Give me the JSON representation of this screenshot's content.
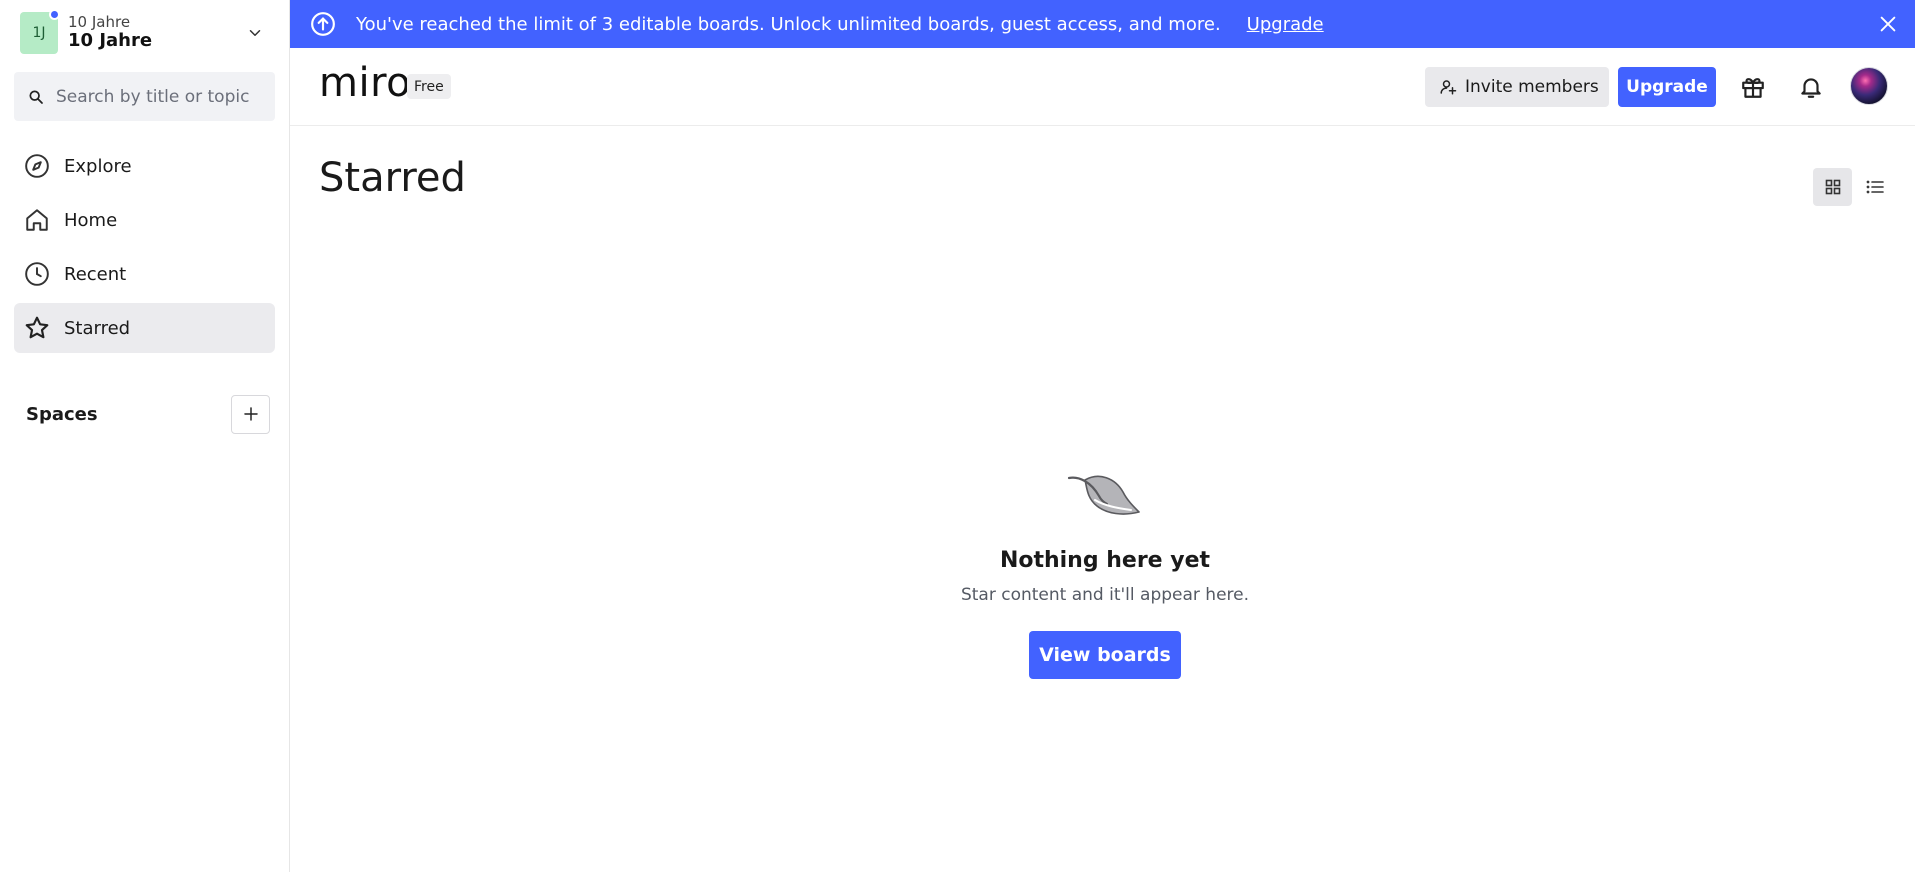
{
  "team": {
    "avatar_initials": "1J",
    "subtitle": "10 Jahre",
    "name": "10 Jahre"
  },
  "search": {
    "placeholder": "Search by title or topic",
    "value": ""
  },
  "nav": {
    "items": [
      {
        "label": "Explore",
        "icon": "compass-icon",
        "active": false
      },
      {
        "label": "Home",
        "icon": "home-icon",
        "active": false
      },
      {
        "label": "Recent",
        "icon": "clock-icon",
        "active": false
      },
      {
        "label": "Starred",
        "icon": "star-icon",
        "active": true
      }
    ]
  },
  "spaces": {
    "title": "Spaces",
    "add_icon": "plus-icon"
  },
  "banner": {
    "text": "You've reached the limit of 3 editable boards. Unlock unlimited boards, guest access, and more.",
    "link": "Upgrade"
  },
  "header": {
    "logo": "miro",
    "plan": "Free",
    "invite_label": "Invite members",
    "upgrade_label": "Upgrade"
  },
  "main": {
    "title": "Starred",
    "empty_title": "Nothing here yet",
    "empty_subtitle": "Star content and it'll appear here.",
    "cta_label": "View boards"
  },
  "colors": {
    "accent": "#4262ff",
    "team_avatar_bg": "#b5ebc6",
    "active_nav_bg": "#ebebee"
  }
}
